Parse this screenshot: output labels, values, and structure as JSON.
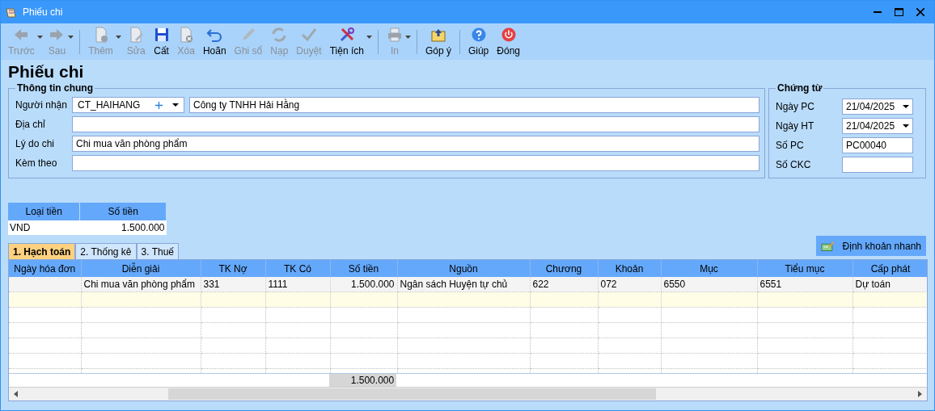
{
  "window": {
    "title": "Phiếu chi"
  },
  "toolbar": [
    [
      {
        "label": "Trước",
        "disabled": true,
        "dropdown": true
      },
      {
        "label": "Sau",
        "disabled": true,
        "dropdown": true
      }
    ],
    [
      {
        "label": "Thêm",
        "disabled": true,
        "dropdown": true
      },
      {
        "label": "Sửa",
        "disabled": true,
        "dropdown": false
      },
      {
        "label": "Cất",
        "disabled": false,
        "dropdown": false
      },
      {
        "label": "Xóa",
        "disabled": true,
        "dropdown": false
      },
      {
        "label": "Hoãn",
        "disabled": false,
        "dropdown": false
      },
      {
        "label": "Ghi sổ",
        "disabled": true,
        "dropdown": false
      },
      {
        "label": "Nạp",
        "disabled": true,
        "dropdown": false
      },
      {
        "label": "Duyệt",
        "disabled": true,
        "dropdown": false
      },
      {
        "label": "Tiện ích",
        "disabled": false,
        "dropdown": true
      }
    ],
    [
      {
        "label": "In",
        "disabled": true,
        "dropdown": true
      }
    ],
    [
      {
        "label": "Góp ý",
        "disabled": false,
        "dropdown": false
      }
    ],
    [
      {
        "label": "Giúp",
        "disabled": false,
        "dropdown": false
      },
      {
        "label": "Đóng",
        "disabled": false,
        "dropdown": false
      }
    ]
  ],
  "heading": "Phiếu chi",
  "general": {
    "legend": "Thông tin chung",
    "recipient": {
      "label": "Người nhận",
      "code": "CT_HAIHANG",
      "name": "Công ty TNHH Hải Hằng"
    },
    "fields": [
      {
        "label": "Địa chỉ"
      },
      {
        "label": "Lý do chi",
        "value": "Chi mua văn phòng phẩm"
      },
      {
        "label": "Kèm theo"
      }
    ]
  },
  "voucher": {
    "legend": "Chứng từ",
    "fields": [
      {
        "label": "Ngày PC",
        "value": "21/04/2025",
        "kind": "date"
      },
      {
        "label": "Ngày HT",
        "value": "21/04/2025",
        "kind": "date"
      },
      {
        "label": "Số PC",
        "value": "PC00040",
        "kind": "text"
      },
      {
        "label": "Số CKC",
        "kind": "text"
      }
    ]
  },
  "currency_table": {
    "columns": [
      "Loại tiền",
      "Số tiền"
    ],
    "rows": [
      [
        "VND",
        "1.500.000"
      ]
    ]
  },
  "tabs": [
    {
      "label": "1. Hạch toán",
      "selected": true
    },
    {
      "label": "2. Thống kê",
      "selected": false
    },
    {
      "label": "3. Thuế",
      "selected": false
    }
  ],
  "quick_entry_button": "Định khoản nhanh",
  "grid": {
    "columns": [
      "Ngày hóa đơn",
      "Diễn giải",
      "TK Nợ",
      "TK Có",
      "Số tiền",
      "Nguồn",
      "Chương",
      "Khoản",
      "Mục",
      "Tiểu mục",
      "Cấp phát"
    ],
    "rows": [
      {
        "cells_from_column_2": [
          "Chi mua văn phòng phẩm",
          "331",
          "1111",
          "1.500.000",
          "Ngân sách Huyện tự chủ",
          "622",
          "072",
          "6550",
          "6551",
          "Dự toán"
        ]
      }
    ],
    "new_row_highlight": true,
    "total_amount": "1.500.000"
  }
}
